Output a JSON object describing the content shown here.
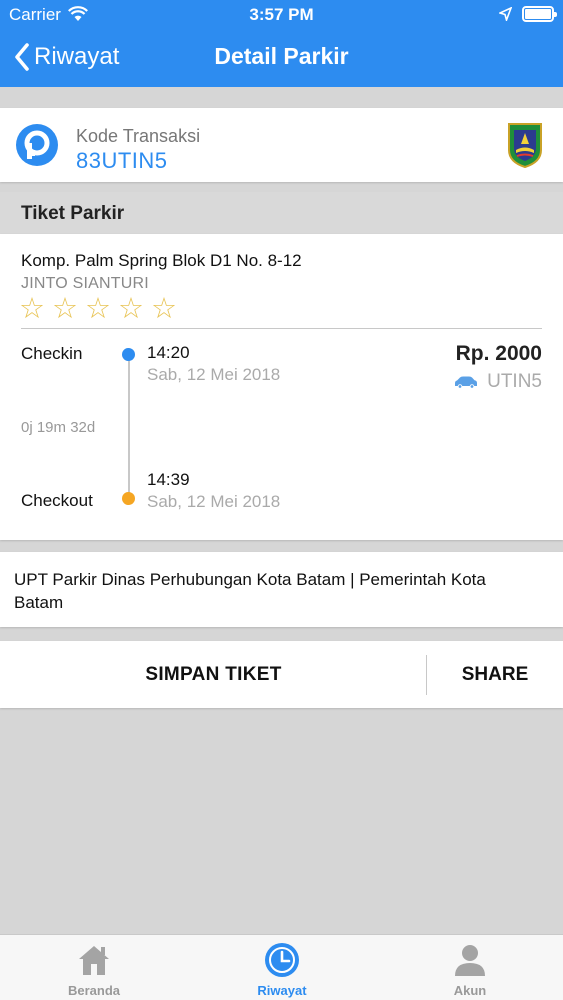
{
  "status_bar": {
    "carrier": "Carrier",
    "time": "3:57 PM"
  },
  "nav": {
    "back_label": "Riwayat",
    "title": "Detail Parkir"
  },
  "transaction": {
    "label": "Kode Transaksi",
    "code": "83UTIN5"
  },
  "ticket": {
    "section_title": "Tiket Parkir",
    "address": "Komp. Palm Spring Blok D1 No. 8-12",
    "attendant": "JINTO SIANTURI",
    "rating": 0,
    "rating_max": 5,
    "checkin_label": "Checkin",
    "checkin_time": "14:20",
    "checkin_date": "Sab, 12 Mei 2018",
    "duration": "0j 19m 32d",
    "checkout_label": "Checkout",
    "checkout_time": "14:39",
    "checkout_date": "Sab, 12 Mei 2018",
    "price": "Rp. 2000",
    "plate": "UTIN5"
  },
  "organization": "UPT Parkir Dinas Perhubungan Kota Batam | Pemerintah Kota Batam",
  "actions": {
    "save_label": "SIMPAN TIKET",
    "share_label": "SHARE"
  },
  "tabs": [
    {
      "label": "Beranda",
      "icon": "house-icon",
      "active": false
    },
    {
      "label": "Riwayat",
      "icon": "clock-icon",
      "active": true
    },
    {
      "label": "Akun",
      "icon": "person-icon",
      "active": false
    }
  ],
  "colors": {
    "primary": "#2d8cf0",
    "checkout_dot": "#f5a623",
    "star": "#e8c456"
  },
  "icons": [
    "wifi-icon",
    "location-arrow-icon",
    "battery-icon",
    "back-chevron-icon",
    "parking-logo-icon",
    "batam-crest-icon",
    "star-icon",
    "car-icon"
  ]
}
